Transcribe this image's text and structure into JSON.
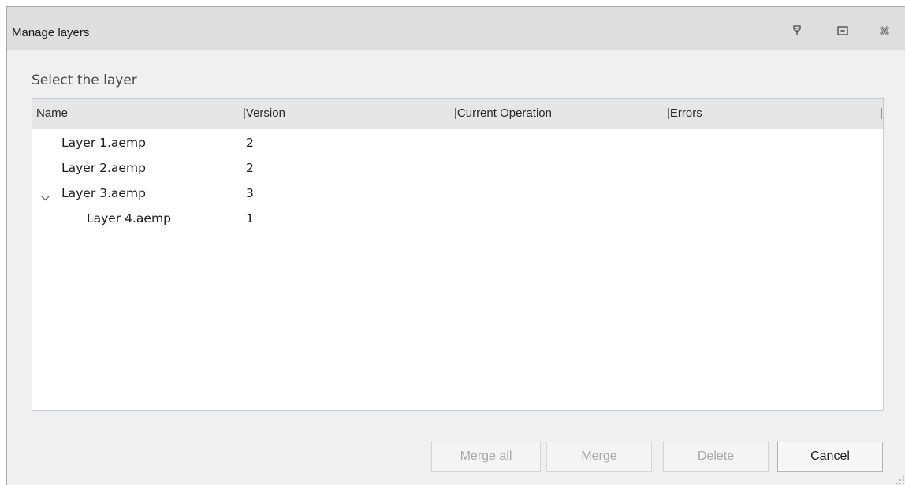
{
  "window": {
    "title": "Manage layers",
    "controls": {
      "pin_icon": "pin-icon",
      "restore_icon": "restore-icon",
      "close_icon": "close-icon"
    }
  },
  "section_label": "Select the layer",
  "table": {
    "columns": [
      {
        "label": "Name"
      },
      {
        "label": "|Version"
      },
      {
        "label": "|Current Operation"
      },
      {
        "label": "|Errors"
      },
      {
        "label": "|"
      }
    ],
    "rows": [
      {
        "name": "Layer 1.aemp",
        "version": "2",
        "level": 0,
        "expanded": null
      },
      {
        "name": "Layer 2.aemp",
        "version": "2",
        "level": 0,
        "expanded": null
      },
      {
        "name": "Layer 3.aemp",
        "version": "3",
        "level": 0,
        "expanded": true
      },
      {
        "name": "Layer 4.aemp",
        "version": "1",
        "level": 1,
        "expanded": null
      }
    ]
  },
  "buttons": {
    "merge_all": {
      "label": "Merge all",
      "enabled": false
    },
    "merge": {
      "label": "Merge",
      "enabled": false
    },
    "delete": {
      "label": "Delete",
      "enabled": false
    },
    "cancel": {
      "label": "Cancel",
      "enabled": true
    }
  }
}
